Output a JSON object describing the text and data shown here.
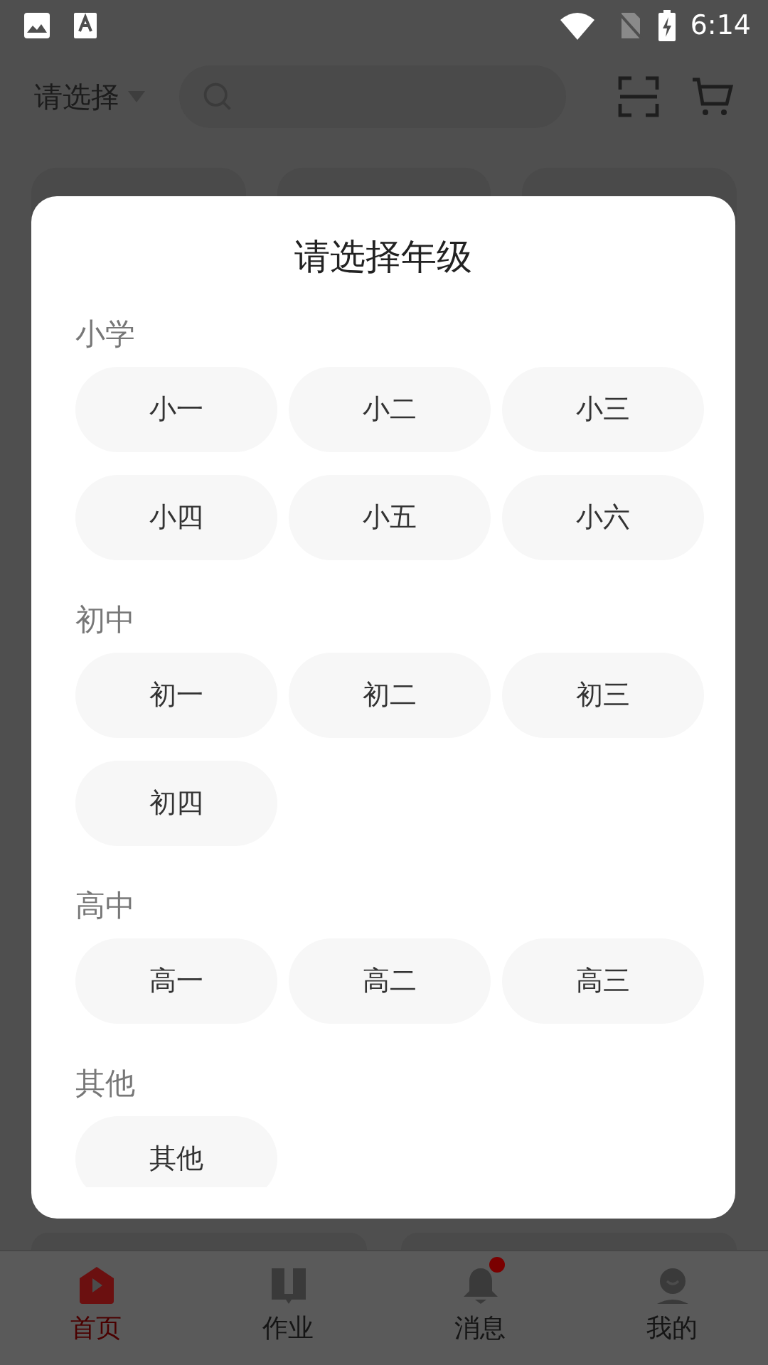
{
  "status_bar": {
    "time": "6:14"
  },
  "top_bar": {
    "grade_picker": "请选择"
  },
  "dialog": {
    "title": "请选择年级",
    "sections": [
      {
        "label": "小学",
        "options": [
          "小一",
          "小二",
          "小三",
          "小四",
          "小五",
          "小六"
        ]
      },
      {
        "label": "初中",
        "options": [
          "初一",
          "初二",
          "初三",
          "初四"
        ]
      },
      {
        "label": "高中",
        "options": [
          "高一",
          "高二",
          "高三"
        ]
      },
      {
        "label": "其他",
        "options": [
          "其他"
        ]
      }
    ]
  },
  "bottom_nav": [
    {
      "label": "首页",
      "selected": true,
      "badge": false
    },
    {
      "label": "作业",
      "selected": false,
      "badge": false
    },
    {
      "label": "消息",
      "selected": false,
      "badge": true
    },
    {
      "label": "我的",
      "selected": false,
      "badge": false
    }
  ]
}
